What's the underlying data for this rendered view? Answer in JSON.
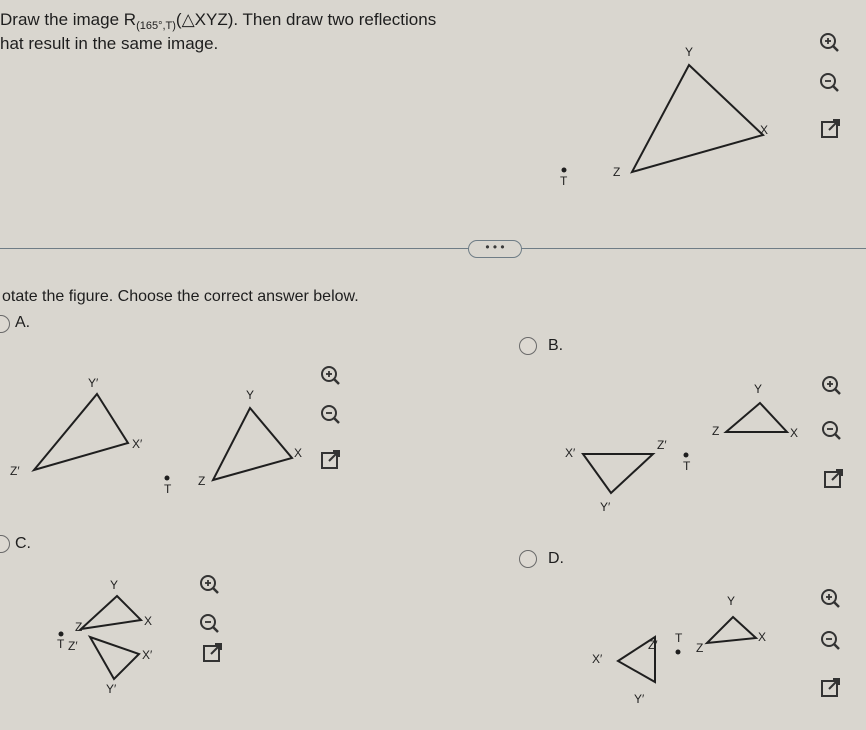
{
  "question": {
    "line1_prefix": "Draw the image R",
    "rotation_subscript": "(165°,T)",
    "triangle_expr": "(△XYZ). Then draw two reflections",
    "line2": "hat result in the same image."
  },
  "divider": {
    "more_label": "• • •"
  },
  "instruction": "otate the figure. Choose the correct answer below.",
  "options": [
    {
      "letter": "A.",
      "selected": false
    },
    {
      "letter": "B.",
      "selected": false
    },
    {
      "letter": "C.",
      "selected": false
    },
    {
      "letter": "D.",
      "selected": false
    }
  ],
  "labels": {
    "X": "X",
    "Y": "Y",
    "Z": "Z",
    "T": "T",
    "Xp": "X′",
    "Yp": "Y′",
    "Zp": "Z′"
  },
  "tools": {
    "zoom_in": "zoom-in-icon",
    "zoom_out": "zoom-out-icon",
    "open_new": "open-new-window-icon"
  },
  "colors": {
    "background": "#d9d6cf",
    "stroke": "#1f1f1f",
    "divider": "#6f7d86"
  }
}
